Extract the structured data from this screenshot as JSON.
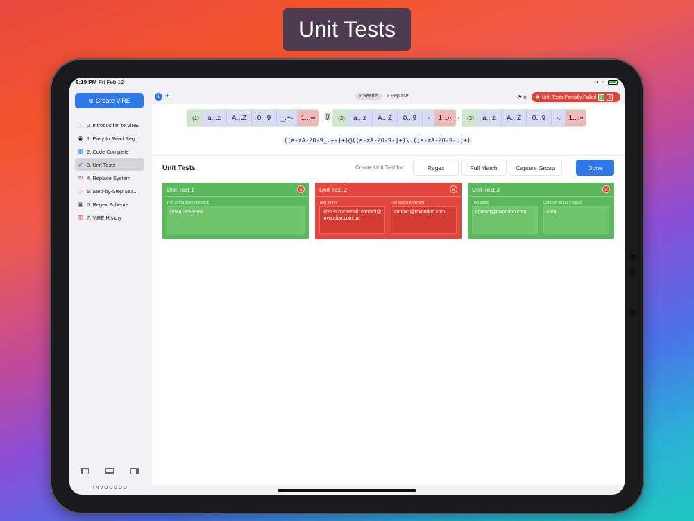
{
  "banner": {
    "title": "Unit Tests"
  },
  "statusbar": {
    "time": "9:19 PM",
    "date": "Fri Feb 12"
  },
  "sidebar": {
    "create_label": "Create ViRE",
    "items": [
      {
        "label": "0. Introduction to ViRE",
        "icon": "info-icon"
      },
      {
        "label": "1. Easy to Read Reg...",
        "icon": "eye-icon"
      },
      {
        "label": "2. Code Complete",
        "icon": "qr-code-icon"
      },
      {
        "label": "3. Unit Tests",
        "icon": "check-circle-icon",
        "active": true
      },
      {
        "label": "4. Replace System",
        "icon": "replace-icon"
      },
      {
        "label": "5. Step-by-Step Sea...",
        "icon": "step-play-icon"
      },
      {
        "label": "6. Regex Scheme",
        "icon": "scheme-square-icon"
      },
      {
        "label": "7. ViRE History",
        "icon": "book-icon"
      }
    ],
    "brand": "INVOODOO"
  },
  "topbar": {
    "tab_number": "1",
    "search_label": "Search",
    "replace_label": "Replace",
    "flag_label": "m",
    "status_label": "Unit Tests Partially Failed",
    "pass_count": "2",
    "fail_count": "1",
    "accent": "#2f78ea",
    "fail_color": "#e3423a"
  },
  "regex_visual": {
    "groups": [
      {
        "index": "(1)",
        "tokens": [
          "a...z",
          "A...Z",
          "0...9",
          "_.+-"
        ],
        "quant": "1...∞"
      },
      {
        "index": "(2)",
        "tokens": [
          "a...z",
          "A...Z",
          "0...9",
          "-"
        ],
        "quant": "1...∞"
      },
      {
        "index": "(3)",
        "tokens": [
          "a...z",
          "A...Z",
          "0...9",
          "-."
        ],
        "quant": "1...∞"
      }
    ],
    "separators": [
      "@",
      "."
    ],
    "pattern": "([a-zA-Z0-9_.+-]+)@([a-zA-Z0-9-]+)\\.([a-zA-Z0-9-.]+)"
  },
  "panel": {
    "title": "Unit Tests",
    "create_label": "Create Unit Test for:",
    "options": [
      "Regex",
      "Full Match",
      "Capture Group"
    ],
    "done_label": "Done"
  },
  "tests": [
    {
      "title": "Unit Test 1",
      "status": "pass",
      "fields": [
        {
          "label": "Test string doesn't match",
          "value": "(650) 285-8585"
        }
      ]
    },
    {
      "title": "Unit Test 2",
      "status": "fail",
      "fields": [
        {
          "label": "Test string",
          "value": "This is our email: contact@invoodoo.com.ua"
        },
        {
          "label": "Full match ends with",
          "value": "contact@invoodoo.com"
        }
      ]
    },
    {
      "title": "Unit Test 3",
      "status": "pass",
      "fields": [
        {
          "label": "Test string",
          "value": "contact@invoodoo.com"
        },
        {
          "label": "Capture group 3 equal",
          "value": "com"
        }
      ]
    }
  ],
  "colors": {
    "pass": "#5cb85c",
    "fail": "#e2463d"
  }
}
